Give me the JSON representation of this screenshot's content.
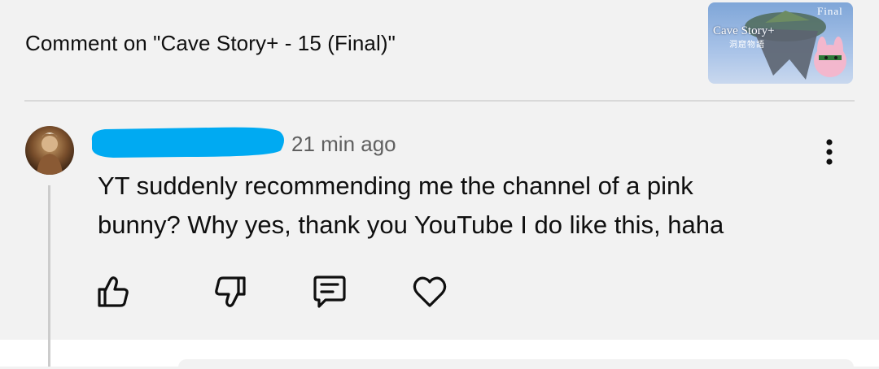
{
  "header": {
    "title": "Comment on \"Cave Story+ - 15 (Final)\""
  },
  "thumbnail": {
    "title": "Cave Story+",
    "subtitle": "洞窟物語",
    "badge": "Final"
  },
  "comment": {
    "timestamp": "21 min ago",
    "text_line1": "YT suddenly recommending me the channel of a pink",
    "text_line2": "bunny? Why yes, thank you YouTube I do like this, haha"
  },
  "icons": {
    "more": "more-vertical-icon",
    "like": "thumbs-up-icon",
    "dislike": "thumbs-down-icon",
    "reply": "comment-icon",
    "heart": "heart-icon"
  },
  "colors": {
    "background": "#f2f2f2",
    "redaction": "#00aaf2",
    "secondary_text": "#606060"
  }
}
